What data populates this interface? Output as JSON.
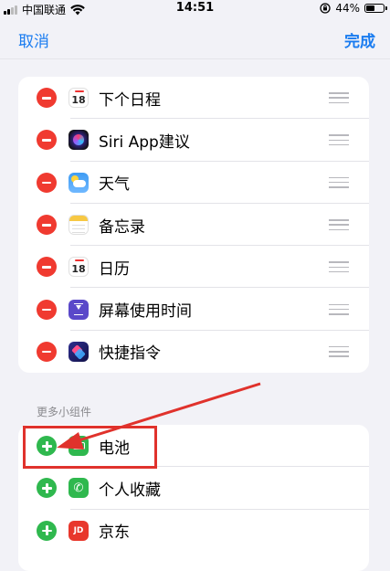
{
  "status_bar": {
    "carrier": "中国联通",
    "time": "14:51",
    "battery_percent": "44%",
    "battery_level": 0.44
  },
  "nav": {
    "cancel_label": "取消",
    "done_label": "完成"
  },
  "widgets": [
    {
      "label": "下个日程",
      "icon": "calendar-icon",
      "calendar_day": "18"
    },
    {
      "label": "Siri App建议",
      "icon": "siri-icon"
    },
    {
      "label": "天气",
      "icon": "weather-icon"
    },
    {
      "label": "备忘录",
      "icon": "notes-icon"
    },
    {
      "label": "日历",
      "icon": "calendar-icon",
      "calendar_day": "18"
    },
    {
      "label": "屏幕使用时间",
      "icon": "screen-time-icon"
    },
    {
      "label": "快捷指令",
      "icon": "shortcuts-icon"
    }
  ],
  "more_widgets": {
    "header": "更多小组件",
    "items": [
      {
        "label": "电池",
        "icon": "battery-icon"
      },
      {
        "label": "个人收藏",
        "icon": "phone-icon"
      },
      {
        "label": "京东",
        "icon": "jd-icon",
        "icon_text": "JD"
      }
    ]
  },
  "colors": {
    "accent": "#1a7cf0",
    "remove": "#f03a30",
    "add": "#2fb84e",
    "annotation": "#e0322c"
  }
}
